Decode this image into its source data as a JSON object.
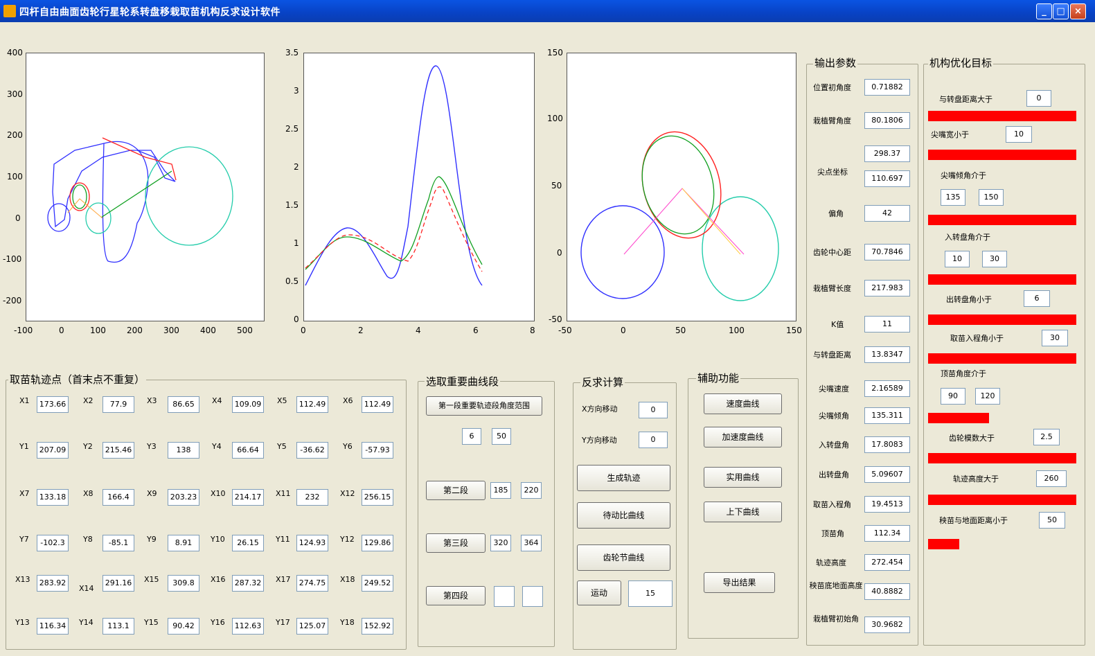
{
  "window": {
    "title": "四杆自由曲面齿轮行星轮系转盘移栽取苗机构反求设计软件",
    "buttons": [
      "_",
      "□",
      "×"
    ],
    "icon": "matlab-figure-icon"
  },
  "plots": [
    {
      "id": "plot1",
      "xticks": [
        "-100",
        "0",
        "100",
        "200",
        "300",
        "400",
        "500"
      ],
      "yticks": [
        "400",
        "300",
        "200",
        "100",
        "0",
        "-100",
        "-200"
      ]
    },
    {
      "id": "plot2",
      "xticks": [
        "0",
        "2",
        "4",
        "6",
        "8"
      ],
      "yticks": [
        "3.5",
        "3",
        "2.5",
        "2",
        "1.5",
        "1",
        "0.5",
        "0"
      ]
    },
    {
      "id": "plot3",
      "xticks": [
        "-50",
        "0",
        "50",
        "100",
        "150"
      ],
      "yticks": [
        "150",
        "100",
        "50",
        "0",
        "-50"
      ]
    }
  ],
  "trajectory": {
    "title": "取苗轨迹点（首末点不重复）",
    "rows": [
      {
        "cells": [
          {
            "l": "X1",
            "v": "173.66"
          },
          {
            "l": "X2",
            "v": "77.9"
          },
          {
            "l": "X3",
            "v": "86.65"
          },
          {
            "l": "X4",
            "v": "109.09"
          },
          {
            "l": "X5",
            "v": "112.49"
          },
          {
            "l": "X6",
            "v": "112.49"
          }
        ]
      },
      {
        "cells": [
          {
            "l": "Y1",
            "v": "207.09"
          },
          {
            "l": "Y2",
            "v": "215.46"
          },
          {
            "l": "Y3",
            "v": "138"
          },
          {
            "l": "Y4",
            "v": "66.64"
          },
          {
            "l": "Y5",
            "v": "-36.62"
          },
          {
            "l": "Y6",
            "v": "-57.93"
          }
        ]
      },
      {
        "cells": [
          {
            "l": "X7",
            "v": "133.18"
          },
          {
            "l": "X8",
            "v": "166.4"
          },
          {
            "l": "X9",
            "v": "203.23"
          },
          {
            "l": "X10",
            "v": "214.17"
          },
          {
            "l": "X11",
            "v": "232"
          },
          {
            "l": "X12",
            "v": "256.15"
          }
        ]
      },
      {
        "cells": [
          {
            "l": "Y7",
            "v": "-102.3"
          },
          {
            "l": "Y8",
            "v": "-85.1"
          },
          {
            "l": "Y9",
            "v": "8.91"
          },
          {
            "l": "Y10",
            "v": "26.15"
          },
          {
            "l": "Y11",
            "v": "124.93"
          },
          {
            "l": "Y12",
            "v": "129.86"
          }
        ]
      },
      {
        "cells": [
          {
            "l": "X13",
            "v": "283.92"
          },
          {
            "l": "X14",
            "v": "291.16"
          },
          {
            "l": "X15",
            "v": "309.8"
          },
          {
            "l": "X16",
            "v": "287.32"
          },
          {
            "l": "X17",
            "v": "274.75"
          },
          {
            "l": "X18",
            "v": "249.52"
          }
        ]
      },
      {
        "cells": [
          {
            "l": "Y13",
            "v": "116.34"
          },
          {
            "l": "Y14",
            "v": "113.1"
          },
          {
            "l": "Y15",
            "v": "90.42"
          },
          {
            "l": "Y16",
            "v": "112.63"
          },
          {
            "l": "Y17",
            "v": "125.07"
          },
          {
            "l": "Y18",
            "v": "152.92"
          }
        ]
      }
    ]
  },
  "segments": {
    "title": "选取重要曲线段",
    "first_label": "第一段重要轨迹段角度范围",
    "first_values": [
      "6",
      "50"
    ],
    "second_label": "第二段",
    "second_values": [
      "185",
      "220"
    ],
    "third_label": "第三段",
    "third_values": [
      "320",
      "364"
    ],
    "fourth_label": "第四段",
    "fourth_values": [
      "",
      ""
    ]
  },
  "inverse": {
    "title": "反求计算",
    "x_shift_label": "X方向移动",
    "x_shift": "0",
    "y_shift_label": "Y方向移动",
    "y_shift": "0",
    "gen_traj": "生成轨迹",
    "pitch_curve": "待动比曲线",
    "gear_curve": "齿轮节曲线",
    "animate": "运动",
    "animate_value": "15"
  },
  "aux": {
    "title": "辅助功能",
    "b1": "速度曲线",
    "b2": "加速度曲线",
    "b3": "实用曲线",
    "b4": "上下曲线",
    "b5": "导出结果"
  },
  "output": {
    "title": "输出参数",
    "items": [
      {
        "label": "位置初角度",
        "values": [
          "0.71882"
        ]
      },
      {
        "label": "栽植臂角度",
        "values": [
          "80.1806"
        ]
      },
      {
        "label": "尖点坐标",
        "values": [
          "298.37",
          "110.697"
        ]
      },
      {
        "label": "偏角",
        "values": [
          "42"
        ]
      },
      {
        "label": "齿轮中心距",
        "values": [
          "70.7846"
        ]
      },
      {
        "label": "栽植臂长度",
        "values": [
          "217.983"
        ]
      },
      {
        "label": "K值",
        "values": [
          "11"
        ]
      },
      {
        "label": "与转盘距离",
        "values": [
          "13.8347"
        ]
      },
      {
        "label": "尖嘴速度",
        "values": [
          "2.16589"
        ]
      },
      {
        "label": "尖嘴倾角",
        "values": [
          "135.311"
        ]
      },
      {
        "label": "入转盘角",
        "values": [
          "17.8083"
        ]
      },
      {
        "label": "出转盘角",
        "values": [
          "5.09607"
        ]
      },
      {
        "label": "取苗入程角",
        "values": [
          "19.4513"
        ]
      },
      {
        "label": "顶苗角",
        "values": [
          "112.34"
        ]
      },
      {
        "label": "轨迹高度",
        "values": [
          "272.454"
        ]
      },
      {
        "label": "秧苗底地面高度",
        "values": [
          "40.8882"
        ]
      },
      {
        "label": "栽植臂初始角",
        "values": [
          "30.9682"
        ]
      }
    ]
  },
  "goals": {
    "title": "机构优化目标",
    "items": [
      {
        "label": "与转盘距离大于",
        "values": [
          "0"
        ],
        "bar": 1.0
      },
      {
        "label": "尖嘴宽小于",
        "values": [
          "10"
        ],
        "bar": 1.0
      },
      {
        "label": "尖嘴倾角介于",
        "values": [
          "135",
          "150"
        ],
        "bar": 1.0
      },
      {
        "label": "入转盘角介于",
        "values": [
          "10",
          "30"
        ],
        "bar": 1.0
      },
      {
        "label": "出转盘角小于",
        "values": [
          "6"
        ],
        "bar": 1.0
      },
      {
        "label": "取苗入程角小于",
        "values": [
          "30"
        ],
        "bar": 1.0
      },
      {
        "label": "顶苗角度介于",
        "values": [
          "90",
          "120"
        ],
        "bar": 0.41
      },
      {
        "label": "齿轮模数大于",
        "values": [
          "2.5"
        ],
        "bar": 1.0
      },
      {
        "label": "轨迹高度大于",
        "values": [
          "260"
        ],
        "bar": 1.0
      },
      {
        "label": "秧苗与地面距离小于",
        "values": [
          "50"
        ],
        "bar": 0.21
      }
    ]
  }
}
